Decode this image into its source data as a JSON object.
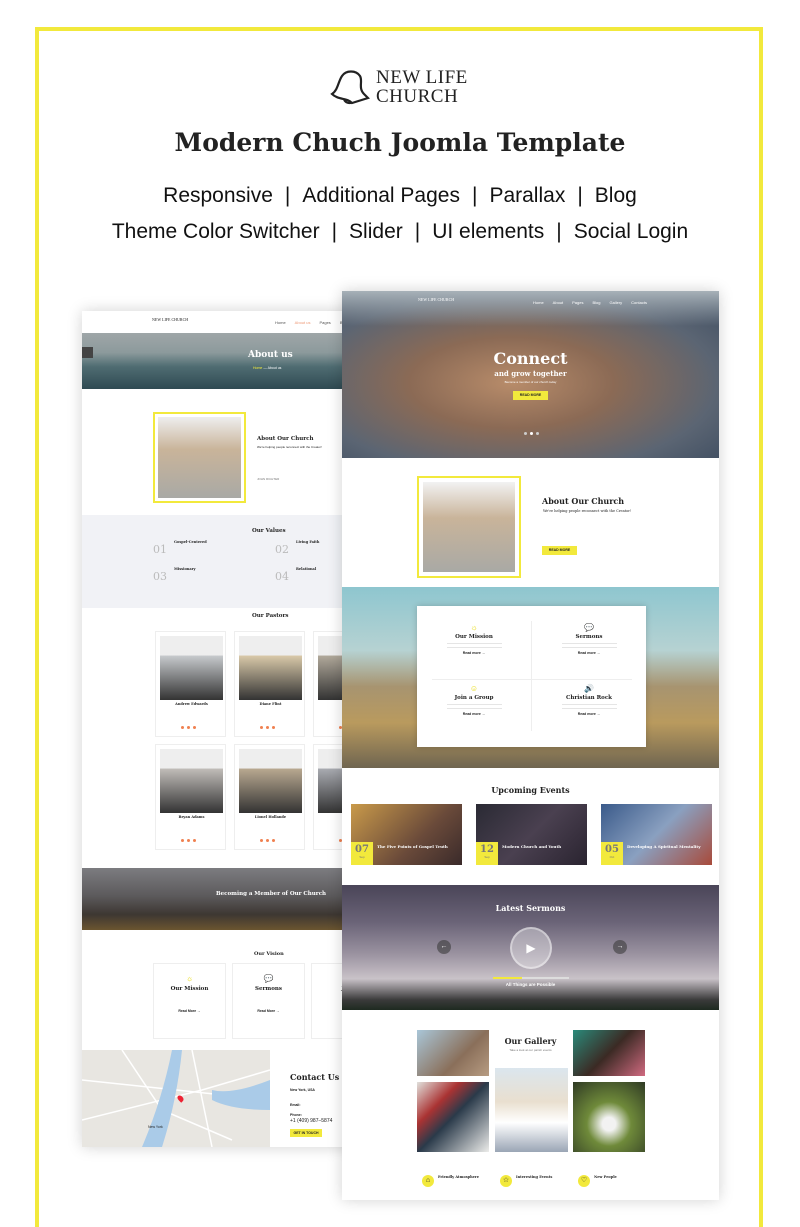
{
  "brand": {
    "line1": "NEW LIFE",
    "line2": "CHURCH",
    "icon": "bell-icon",
    "accent": "#f2e93c"
  },
  "headline": "Modern Chuch Joomla Template",
  "features_row1": [
    "Responsive",
    "Additional Pages",
    "Parallax",
    "Blog"
  ],
  "features_row2": [
    "Theme Color Switcher",
    "Slider",
    "UI elements",
    "Social Login"
  ],
  "separator": "|",
  "left_page": {
    "nav": [
      "Home",
      "About us",
      "Pages",
      "Blog"
    ],
    "hero_title": "About us",
    "breadcrumb": [
      "Home",
      "About us"
    ],
    "about_title": "About Our Church",
    "about_subtitle": "We're helping people reconnect with the Creator!",
    "about_author": "JOHN RICHTER",
    "values_title": "Our Values",
    "values": [
      {
        "num": "01",
        "title": "Gospel-Centered"
      },
      {
        "num": "02",
        "title": "Living Faith"
      },
      {
        "num": "03",
        "title": "Missionary"
      },
      {
        "num": "04",
        "title": "Relational"
      }
    ],
    "pastors_title": "Our Pastors",
    "pastors": [
      "Andrew Edwards",
      "Diane Flint",
      "Craig",
      "Bryan Adams",
      "Lionel Hollande",
      "James"
    ],
    "member_title": "Becoming a Member of Our Church",
    "vision_title": "Our Vision",
    "vision": [
      {
        "title": "Our Mission",
        "link": "Read More →",
        "icon": "sun-icon"
      },
      {
        "title": "Sermons",
        "link": "Read More →",
        "icon": "chat-bubble-icon"
      },
      {
        "title": "Join",
        "link": "Read",
        "icon": "group-icon"
      }
    ],
    "contact_title": "Contact Us",
    "contact_city": "New York, USA",
    "contact_email_label": "Email:",
    "contact_phone_label": "Phone:",
    "contact_phone": "+1 (409) 987–5874",
    "contact_button": "GET IN TOUCH",
    "map_city": "New York"
  },
  "right_page": {
    "nav": [
      "Home",
      "About",
      "Pages",
      "Blog",
      "Gallery",
      "Contacts"
    ],
    "hero_title": "Connect",
    "hero_subtitle": "and grow together",
    "hero_tagline": "Become a member of our church today",
    "hero_button": "READ MORE",
    "about_title": "About Our Church",
    "about_subtitle": "We're helping people reconnect with the Creator!",
    "about_button": "READ MORE",
    "services": [
      {
        "title": "Our Mission",
        "link": "Read more →",
        "icon": "sun-icon"
      },
      {
        "title": "Sermons",
        "link": "Read more →",
        "icon": "chat-bubble-icon"
      },
      {
        "title": "Join a Group",
        "link": "Read more →",
        "icon": "group-icon"
      },
      {
        "title": "Christian Rock",
        "link": "Read more →",
        "icon": "speaker-icon"
      }
    ],
    "events_title": "Upcoming Events",
    "events": [
      {
        "day": "07",
        "month": "Sep",
        "title": "The Five Points of Gospel Truth"
      },
      {
        "day": "12",
        "month": "Sep",
        "title": "Modern Church and Youth"
      },
      {
        "day": "05",
        "month": "Oct",
        "title": "Developing A Spiritual Mentality"
      }
    ],
    "sermons_title": "Latest Sermons",
    "sermon_name": "All Things are Possible",
    "sermon_progress": 0.38,
    "gallery_title": "Our Gallery",
    "gallery_subtitle": "Take a look at our parish events",
    "bottom_features": [
      {
        "title": "Friendly Atmosphere",
        "icon": "house-icon"
      },
      {
        "title": "Interesting Events",
        "icon": "star-icon"
      },
      {
        "title": "New People",
        "icon": "heart-icon"
      }
    ]
  }
}
